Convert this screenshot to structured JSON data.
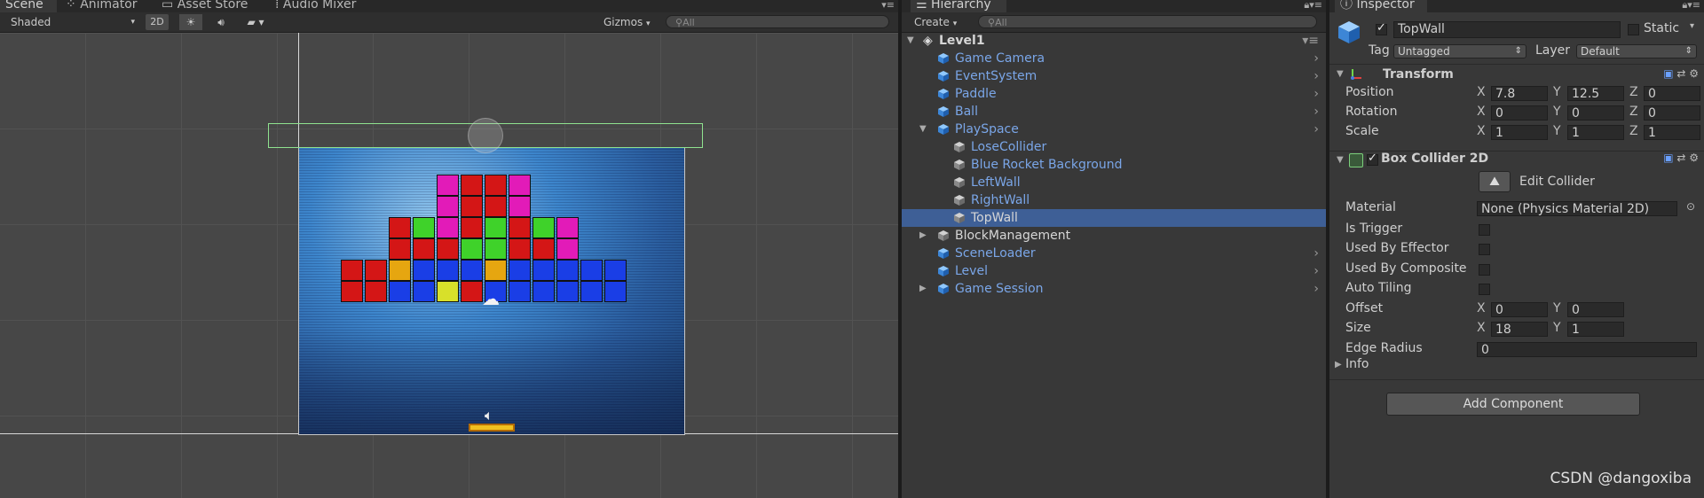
{
  "scene": {
    "tabs": [
      "Scene",
      "Animator",
      "Asset Store",
      "Audio Mixer"
    ],
    "shading_mode": "Shaded",
    "mode_2d": "2D",
    "gizmos_label": "Gizmos",
    "search_placeholder": "All"
  },
  "hierarchy": {
    "tab": "Hierarchy",
    "create_label": "Create",
    "search_placeholder": "All",
    "scene_name": "Level1",
    "items": [
      {
        "label": "Game Camera",
        "depth": 1,
        "style": "prefab",
        "expand": "none",
        "more": true
      },
      {
        "label": "EventSystem",
        "depth": 1,
        "style": "prefab",
        "expand": "none",
        "more": true
      },
      {
        "label": "Paddle",
        "depth": 1,
        "style": "prefab",
        "expand": "none",
        "more": true
      },
      {
        "label": "Ball",
        "depth": 1,
        "style": "prefab",
        "expand": "none",
        "more": true
      },
      {
        "label": "PlaySpace",
        "depth": 1,
        "style": "prefab",
        "expand": "open",
        "more": true
      },
      {
        "label": "LoseCollider",
        "depth": 2,
        "style": "prefab",
        "expand": "none",
        "more": false
      },
      {
        "label": "Blue Rocket Background",
        "depth": 2,
        "style": "prefab",
        "expand": "none",
        "more": false
      },
      {
        "label": "LeftWall",
        "depth": 2,
        "style": "prefab",
        "expand": "none",
        "more": false
      },
      {
        "label": "RightWall",
        "depth": 2,
        "style": "prefab",
        "expand": "none",
        "more": false
      },
      {
        "label": "TopWall",
        "depth": 2,
        "style": "selected",
        "expand": "none",
        "more": false
      },
      {
        "label": "BlockManagement",
        "depth": 1,
        "style": "normal",
        "expand": "closed",
        "more": false
      },
      {
        "label": "SceneLoader",
        "depth": 1,
        "style": "prefab",
        "expand": "none",
        "more": true
      },
      {
        "label": "Level",
        "depth": 1,
        "style": "prefab",
        "expand": "none",
        "more": true
      },
      {
        "label": "Game Session",
        "depth": 1,
        "style": "prefab",
        "expand": "closed",
        "more": true
      }
    ]
  },
  "inspector": {
    "tab": "Inspector",
    "object_name": "TopWall",
    "static_label": "Static",
    "tag_label": "Tag",
    "tag_value": "Untagged",
    "layer_label": "Layer",
    "layer_value": "Default",
    "transform": {
      "title": "Transform",
      "position_label": "Position",
      "position": {
        "x": "7.8",
        "y": "12.5",
        "z": "0"
      },
      "rotation_label": "Rotation",
      "rotation": {
        "x": "0",
        "y": "0",
        "z": "0"
      },
      "scale_label": "Scale",
      "scale": {
        "x": "1",
        "y": "1",
        "z": "1"
      }
    },
    "collider": {
      "title": "Box Collider 2D",
      "edit_label": "Edit Collider",
      "material_label": "Material",
      "material_value": "None (Physics Material 2D)",
      "is_trigger_label": "Is Trigger",
      "used_by_effector_label": "Used By Effector",
      "used_by_composite_label": "Used By Composite",
      "auto_tiling_label": "Auto Tiling",
      "offset_label": "Offset",
      "offset": {
        "x": "0",
        "y": "0"
      },
      "size_label": "Size",
      "size": {
        "x": "18",
        "y": "1"
      },
      "edge_radius_label": "Edge Radius",
      "edge_radius": "0",
      "info_label": "Info"
    },
    "add_component_label": "Add Component"
  },
  "axis_letters": {
    "x": "X",
    "y": "Y",
    "z": "Z"
  },
  "watermark": "CSDN @dangoxiba",
  "colors": {
    "selection": "#3e5f96",
    "prefab_text": "#7aa6e8",
    "collider_outline": "#8fe28f",
    "paddle": "#f0c020"
  },
  "blocks": [
    {
      "row": 0,
      "col": 4,
      "color": "#e21bb8"
    },
    {
      "row": 0,
      "col": 5,
      "color": "#d41616"
    },
    {
      "row": 0,
      "col": 6,
      "color": "#d41616"
    },
    {
      "row": 0,
      "col": 7,
      "color": "#e21bb8"
    },
    {
      "row": 1,
      "col": 4,
      "color": "#e21bb8"
    },
    {
      "row": 1,
      "col": 5,
      "color": "#d41616"
    },
    {
      "row": 1,
      "col": 6,
      "color": "#d41616"
    },
    {
      "row": 1,
      "col": 7,
      "color": "#e21bb8"
    },
    {
      "row": 2,
      "col": 2,
      "color": "#d41616"
    },
    {
      "row": 2,
      "col": 3,
      "color": "#3fd22a"
    },
    {
      "row": 2,
      "col": 4,
      "color": "#e21bb8"
    },
    {
      "row": 2,
      "col": 5,
      "color": "#d41616"
    },
    {
      "row": 2,
      "col": 6,
      "color": "#3fd22a"
    },
    {
      "row": 2,
      "col": 7,
      "color": "#d41616"
    },
    {
      "row": 2,
      "col": 8,
      "color": "#3fd22a"
    },
    {
      "row": 2,
      "col": 9,
      "color": "#e21bb8"
    },
    {
      "row": 3,
      "col": 2,
      "color": "#d41616"
    },
    {
      "row": 3,
      "col": 3,
      "color": "#d41616"
    },
    {
      "row": 3,
      "col": 4,
      "color": "#d41616"
    },
    {
      "row": 3,
      "col": 5,
      "color": "#3fd22a"
    },
    {
      "row": 3,
      "col": 6,
      "color": "#3fd22a"
    },
    {
      "row": 3,
      "col": 7,
      "color": "#d41616"
    },
    {
      "row": 3,
      "col": 8,
      "color": "#d41616"
    },
    {
      "row": 3,
      "col": 9,
      "color": "#e21bb8"
    },
    {
      "row": 4,
      "col": 0,
      "color": "#d41616"
    },
    {
      "row": 4,
      "col": 1,
      "color": "#d41616"
    },
    {
      "row": 4,
      "col": 2,
      "color": "#e6a610"
    },
    {
      "row": 4,
      "col": 3,
      "color": "#1a3ee6"
    },
    {
      "row": 4,
      "col": 4,
      "color": "#1a3ee6"
    },
    {
      "row": 4,
      "col": 5,
      "color": "#1a3ee6"
    },
    {
      "row": 4,
      "col": 6,
      "color": "#e6a610"
    },
    {
      "row": 4,
      "col": 7,
      "color": "#1a3ee6"
    },
    {
      "row": 4,
      "col": 8,
      "color": "#1a3ee6"
    },
    {
      "row": 4,
      "col": 9,
      "color": "#1a3ee6"
    },
    {
      "row": 4,
      "col": 10,
      "color": "#1a3ee6"
    },
    {
      "row": 4,
      "col": 11,
      "color": "#1a3ee6"
    },
    {
      "row": 5,
      "col": 0,
      "color": "#d41616"
    },
    {
      "row": 5,
      "col": 1,
      "color": "#d41616"
    },
    {
      "row": 5,
      "col": 2,
      "color": "#1a3ee6"
    },
    {
      "row": 5,
      "col": 3,
      "color": "#1a3ee6"
    },
    {
      "row": 5,
      "col": 4,
      "color": "#d8e02a"
    },
    {
      "row": 5,
      "col": 5,
      "color": "#d41616"
    },
    {
      "row": 5,
      "col": 6,
      "color": "#1a3ee6"
    },
    {
      "row": 5,
      "col": 7,
      "color": "#1a3ee6"
    },
    {
      "row": 5,
      "col": 8,
      "color": "#1a3ee6"
    },
    {
      "row": 5,
      "col": 9,
      "color": "#1a3ee6"
    },
    {
      "row": 5,
      "col": 10,
      "color": "#1a3ee6"
    },
    {
      "row": 5,
      "col": 11,
      "color": "#1a3ee6"
    }
  ]
}
